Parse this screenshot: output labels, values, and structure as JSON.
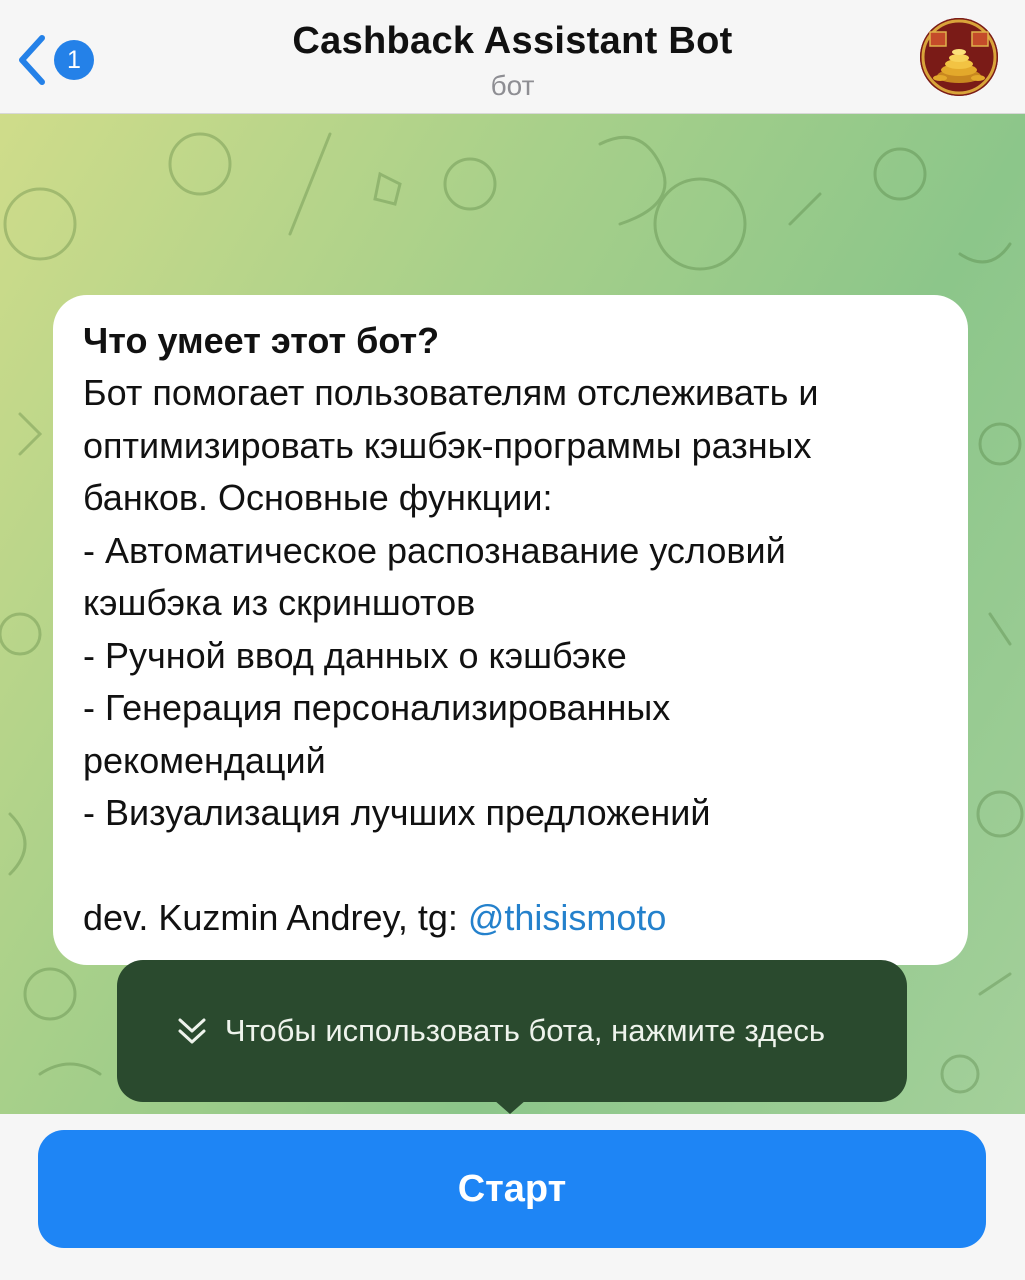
{
  "header": {
    "back_badge_count": "1",
    "title": "Cashback Assistant Bot",
    "subtitle": "бот",
    "avatar_icon": "coins-avatar-icon"
  },
  "message": {
    "title": "Что умеет этот бот?",
    "body": "Бот помогает пользователям отслеживать и\nоптимизировать кэшбэк-программы разных\nбанков. Основные функции:\n- Автоматическое распознавание условий\nкэшбэка из скриншотов\n- Ручной ввод данных о кэшбэке\n- Генерация персонализированных\nрекомендаций\n- Визуализация лучших предложений",
    "footer_prefix": "dev. Kuzmin Andrey, tg: ",
    "footer_link": "@thisismoto"
  },
  "tooltip": {
    "text": "Чтобы использовать бота, нажмите здесь",
    "icon": "double-chevron-down-icon"
  },
  "start_button": {
    "label": "Старт"
  },
  "colors": {
    "accent": "#1e85f5",
    "link": "#2481cc",
    "tooltip_bg": "#2a4a2e",
    "bubble_bg": "#ffffff"
  }
}
